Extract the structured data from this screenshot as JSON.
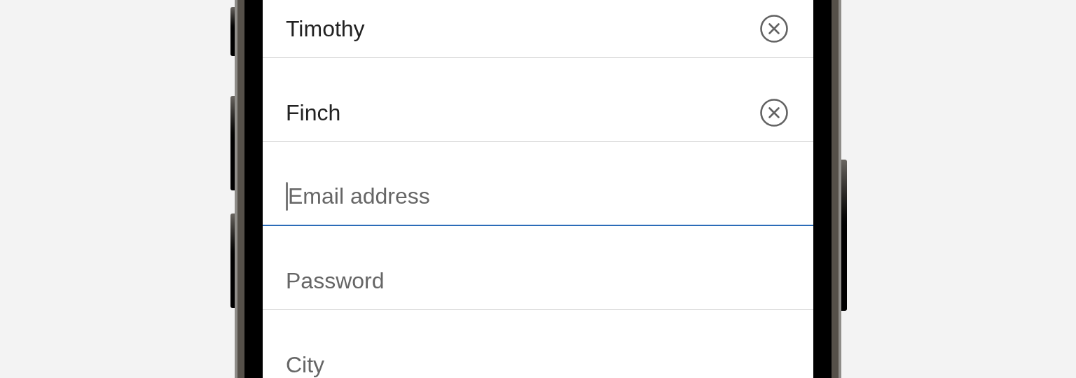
{
  "form": {
    "fields": [
      {
        "value": "Timothy",
        "clear_button": true,
        "focused": false
      },
      {
        "value": "Finch",
        "clear_button": true,
        "focused": false
      },
      {
        "placeholder": "Email address",
        "clear_button": false,
        "focused": true
      },
      {
        "placeholder": "Password",
        "clear_button": false,
        "focused": false
      },
      {
        "placeholder": "City",
        "clear_button": false,
        "focused": false
      }
    ]
  }
}
